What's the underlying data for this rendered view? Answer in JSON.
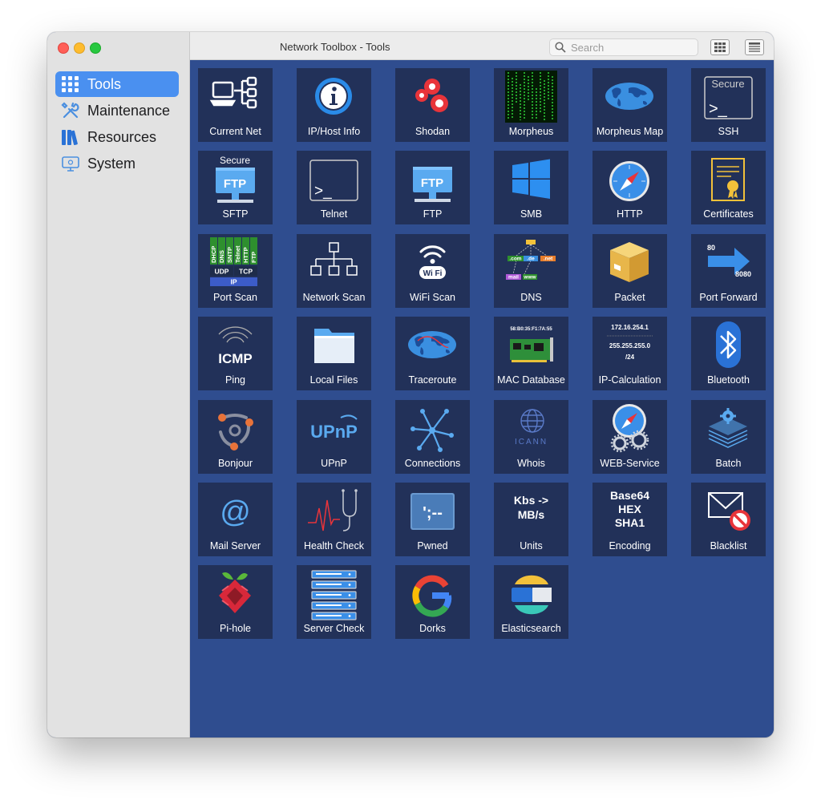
{
  "window": {
    "title": "Network Toolbox - Tools"
  },
  "search": {
    "placeholder": "Search"
  },
  "sidebar": {
    "items": [
      {
        "label": "Tools"
      },
      {
        "label": "Maintenance"
      },
      {
        "label": "Resources"
      },
      {
        "label": "System"
      }
    ]
  },
  "tools": [
    {
      "label": "Current Net"
    },
    {
      "label": "IP/Host Info"
    },
    {
      "label": "Shodan"
    },
    {
      "label": "Morpheus"
    },
    {
      "label": "Morpheus Map"
    },
    {
      "label": "SSH"
    },
    {
      "label": "SFTP"
    },
    {
      "label": "Telnet"
    },
    {
      "label": "FTP"
    },
    {
      "label": "SMB"
    },
    {
      "label": "HTTP"
    },
    {
      "label": "Certificates"
    },
    {
      "label": "Port Scan"
    },
    {
      "label": "Network Scan"
    },
    {
      "label": "WiFi Scan"
    },
    {
      "label": "DNS"
    },
    {
      "label": "Packet"
    },
    {
      "label": "Port Forward"
    },
    {
      "label": "Ping"
    },
    {
      "label": "Local Files"
    },
    {
      "label": "Traceroute"
    },
    {
      "label": "MAC Database"
    },
    {
      "label": "IP-Calculation"
    },
    {
      "label": "Bluetooth"
    },
    {
      "label": "Bonjour"
    },
    {
      "label": "UPnP"
    },
    {
      "label": "Connections"
    },
    {
      "label": "Whois"
    },
    {
      "label": "WEB-Service"
    },
    {
      "label": "Batch"
    },
    {
      "label": "Mail Server"
    },
    {
      "label": "Health Check"
    },
    {
      "label": "Pwned"
    },
    {
      "label": "Units"
    },
    {
      "label": "Encoding"
    },
    {
      "label": "Blacklist"
    },
    {
      "label": "Pi-hole"
    },
    {
      "label": "Server Check"
    },
    {
      "label": "Dorks"
    },
    {
      "label": "Elasticsearch"
    }
  ],
  "icon_text": {
    "ssh_secure": "Secure",
    "ssh_prompt": ">_",
    "sftp_secure": "Secure",
    "ftp": "FTP",
    "telnet_prompt": ">_",
    "portscan": [
      "DHCP",
      "DNS",
      "SNTP",
      "Telnet",
      "HTTP",
      "FTP"
    ],
    "portscan_udp": "UDP",
    "portscan_tcp": "TCP",
    "portscan_ip": "IP",
    "wifi": "Wi Fi",
    "dns_labels": [
      ".com",
      ".de",
      ".net",
      "mail",
      "www"
    ],
    "portfwd_from": "80",
    "portfwd_to": "8080",
    "icmp": "ICMP",
    "mac": "58:B0:35:F1:7A:55",
    "ipcalc": [
      "172.16.254.1",
      "255.255.255.0",
      "/24"
    ],
    "upnp": "UPnP",
    "icann": "ICANN",
    "at": "@",
    "pwned": "';--",
    "units": [
      "Kbs ->",
      "MB/s"
    ],
    "encoding": [
      "Base64",
      "HEX",
      "SHA1"
    ]
  },
  "colors": {
    "tile": "#223159",
    "content": "#2f4d8f",
    "sidebar_selected": "#4a90f0",
    "accent_blue": "#2a8be8"
  }
}
